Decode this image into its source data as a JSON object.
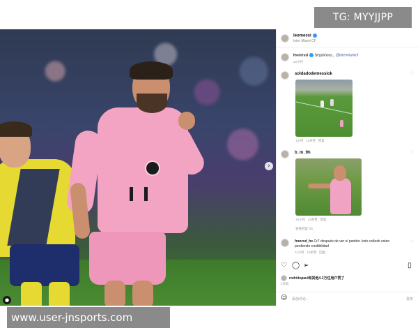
{
  "watermark_top": "TG: MYYJJPP",
  "watermark_bottom": "www.user-jnsports.com",
  "post": {
    "author": "leomessi",
    "location": "Inter Miami CF",
    "caption_user": "leomessi",
    "caption_text": "Seguimoss...",
    "caption_mention": "@intermiamicf",
    "caption_time": "23小时",
    "comments": [
      {
        "user": "soldadodemessiok",
        "meta": [
          "1小时",
          "11条赞",
          "回复"
        ]
      },
      {
        "user": "b_m_9h",
        "meta": [
          "15小时",
          "12条赞",
          "回复"
        ],
        "view_replies": "查看回复 (8)"
      },
      {
        "user": "franrod_he",
        "text_line1": "Cr7 después de ver el partido: losh cañosh estan",
        "text_line2": "perdiendo credibilidad",
        "meta": [
          "11小时",
          "13条赞",
          "回复"
        ]
      }
    ],
    "liked_by": "rodridepaul和其他4.3万位用户赞了",
    "post_time": "4天前",
    "add_comment_placeholder": "添加评论...",
    "post_button": "发布"
  },
  "icons": {
    "photo_next": "chevron-right-icon",
    "photo_user": "user-tag-icon",
    "like": "heart-icon",
    "comment": "comment-icon",
    "share": "send-icon",
    "save": "bookmark-icon",
    "emoji": "emoji-icon"
  },
  "colors": {
    "jersey_pink": "#f3a4c3",
    "opponent_yellow": "#e5d932",
    "link_blue": "#3b5b9a",
    "verified_blue": "#3897f0"
  }
}
